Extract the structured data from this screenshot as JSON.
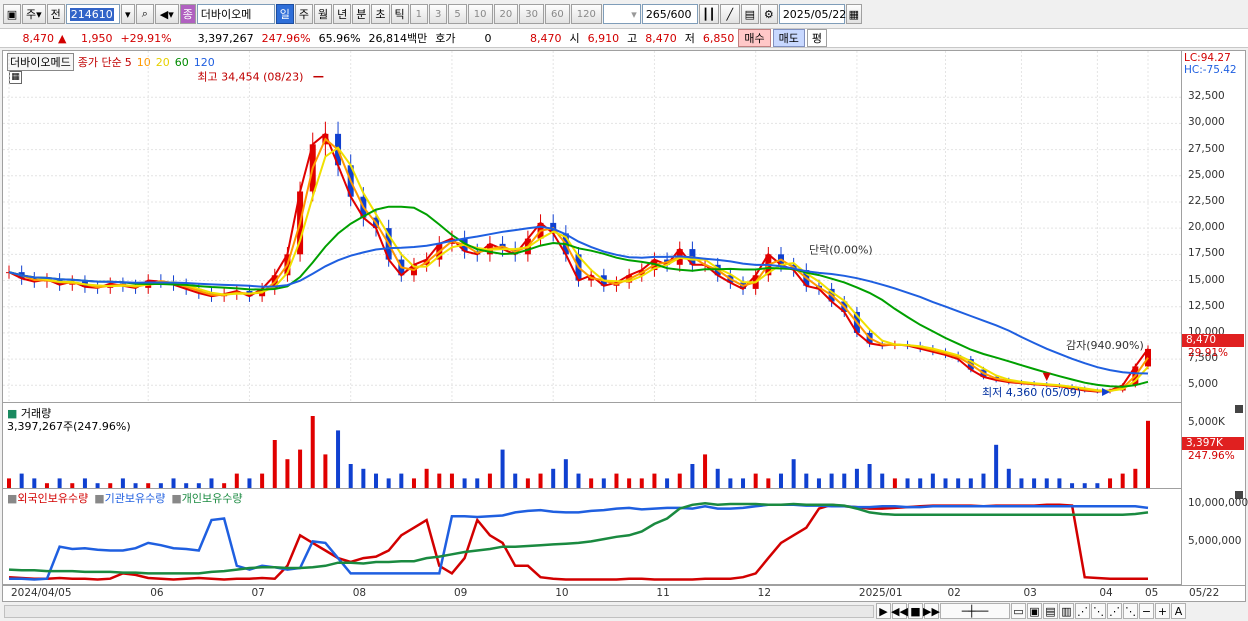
{
  "toolbar": {
    "market": "주",
    "jeon": "전",
    "code": "214610",
    "name_badge": "종",
    "stock_name": "더바이오메",
    "periods": [
      "일",
      "주",
      "월",
      "년",
      "분",
      "초",
      "틱"
    ],
    "active_period": "일",
    "nums": [
      "1",
      "3",
      "5",
      "10",
      "20",
      "30",
      "60",
      "120"
    ],
    "range": "265",
    "range_total": "/600",
    "date": "2025/05/22"
  },
  "quote": {
    "price": "8,470",
    "change": "1,950",
    "change_pct": "+29.91%",
    "volume": "3,397,267",
    "vol_ratio": "247.96%",
    "turnover": "65.96%",
    "amount": "26,814백만",
    "hoga_label": "호가",
    "hoga_value": "0",
    "hoga_price": "8,470",
    "open_label": "시",
    "open": "6,910",
    "high_label": "고",
    "high": "8,470",
    "low_label": "저",
    "low": "6,850",
    "buy": "매수",
    "sell": "매도",
    "pyeong": "평"
  },
  "price_pane": {
    "stock_box": "더바이오메드",
    "legend_title": "종가 단순",
    "ma": [
      {
        "label": "5",
        "color": "#e00000"
      },
      {
        "label": "10",
        "color": "#ff9900"
      },
      {
        "label": "20",
        "color": "#f0e000"
      },
      {
        "label": "60",
        "color": "#00a000"
      },
      {
        "label": "120",
        "color": "#1f5fe0"
      }
    ],
    "lc": "LC:94.27",
    "hc": "HC:-75.42",
    "ticks": [
      "32,500",
      "30,000",
      "27,500",
      "25,000",
      "22,500",
      "20,000",
      "17,500",
      "15,000",
      "12,500",
      "10,000",
      "7,500",
      "5,000"
    ],
    "price_tag": "8,470",
    "pct_tag": "29.91%",
    "annot_high": "최고 34,454 (08/23)",
    "annot_low": "최저 4,360 (05/09)",
    "annot_gamja": "감자(940.90%)",
    "annot_dan": "단락(0.00%)"
  },
  "volume_pane": {
    "title": "거래량",
    "sub": "3,397,267주(247.96%)",
    "tick": "5,000K",
    "tag": "3,397K",
    "tag_pct": "247.96%"
  },
  "holding_pane": {
    "legends": [
      {
        "label": "외국인보유수량",
        "color": "#d20000"
      },
      {
        "label": "기관보유수량",
        "color": "#1f5fe0"
      },
      {
        "label": "개인보유수량",
        "color": "#1a8a40"
      }
    ],
    "ticks": [
      "10,000,000",
      "5,000,000"
    ]
  },
  "xaxis": [
    "2024/04/05",
    "06",
    "07",
    "08",
    "09",
    "10",
    "11",
    "12",
    "2025/01",
    "02",
    "03",
    "04",
    "05",
    "05/22"
  ],
  "chart_data": {
    "type": "line",
    "ylim": [
      3500,
      35000
    ],
    "close": [
      15800,
      15200,
      14900,
      15100,
      14600,
      14900,
      14400,
      14300,
      14700,
      14500,
      14300,
      15000,
      14900,
      14600,
      14200,
      13800,
      13500,
      13700,
      14000,
      13500,
      14200,
      15500,
      17500,
      23500,
      28000,
      29000,
      26000,
      23000,
      21000,
      20000,
      17000,
      15500,
      16500,
      17000,
      18500,
      19000,
      17800,
      17500,
      18500,
      18000,
      17500,
      19000,
      20500,
      19500,
      17500,
      15000,
      15500,
      14500,
      14800,
      15500,
      16000,
      17000,
      16500,
      18000,
      16500,
      16500,
      15500,
      14800,
      14200,
      15500,
      17500,
      16500,
      16000,
      14500,
      14200,
      13000,
      12000,
      10000,
      9000,
      8800,
      8900,
      8800,
      8500,
      8200,
      7900,
      7500,
      6500,
      5800,
      5500,
      5300,
      5200,
      5100,
      5000,
      4900,
      4700,
      4500,
      4400,
      4500,
      5000,
      6800,
      8470
    ],
    "volume": [
      2,
      3,
      2,
      1,
      2,
      1,
      2,
      1,
      1,
      2,
      1,
      1,
      1,
      2,
      1,
      1,
      2,
      1,
      3,
      2,
      3,
      10,
      6,
      8,
      15,
      7,
      12,
      5,
      4,
      3,
      2,
      3,
      2,
      4,
      3,
      3,
      2,
      2,
      3,
      8,
      3,
      2,
      3,
      4,
      6,
      3,
      2,
      2,
      3,
      2,
      2,
      3,
      2,
      3,
      5,
      7,
      4,
      2,
      2,
      3,
      2,
      3,
      6,
      3,
      2,
      3,
      3,
      4,
      5,
      3,
      2,
      2,
      2,
      3,
      2,
      2,
      2,
      3,
      9,
      4,
      2,
      2,
      2,
      2,
      1,
      1,
      1,
      2,
      3,
      4,
      14
    ],
    "foreign": [
      500,
      400,
      300,
      300,
      400,
      300,
      300,
      200,
      300,
      1000,
      800,
      400,
      300,
      200,
      300,
      400,
      300,
      200,
      300,
      300,
      400,
      300,
      2000,
      6000,
      5000,
      4000,
      3000,
      2500,
      3000,
      3200,
      4000,
      6000,
      7000,
      8000,
      2000,
      1000,
      3000,
      8000,
      6000,
      5000,
      2000,
      2000,
      500,
      300,
      200,
      200,
      200,
      200,
      200,
      300,
      300,
      200,
      200,
      200,
      200,
      300,
      300,
      300,
      500,
      1000,
      3000,
      5000,
      6000,
      7000,
      9500,
      10000,
      9800,
      9700,
      9500,
      9500,
      9600,
      9700,
      9800,
      9900,
      9900,
      9900,
      9900,
      9800,
      9900,
      9900,
      9900,
      9900,
      10000,
      10000,
      9900,
      500,
      400,
      300,
      300,
      300,
      300
    ],
    "institution": [
      300,
      300,
      200,
      300,
      4500,
      4200,
      4300,
      4100,
      4000,
      4000,
      4300,
      5000,
      4700,
      4300,
      4200,
      4000,
      8000,
      8200,
      2000,
      1500,
      2000,
      1800,
      1500,
      1700,
      5200,
      5000,
      3000,
      1000,
      1000,
      1000,
      1000,
      1000,
      1000,
      1000,
      1000,
      8500,
      8500,
      8400,
      8500,
      8600,
      9000,
      9200,
      9300,
      9100,
      9000,
      9000,
      9200,
      9300,
      9500,
      9600,
      9400,
      9500,
      9600,
      9600,
      9500,
      9800,
      9500,
      9500,
      9600,
      9800,
      10000,
      10000,
      10000,
      9900,
      9900,
      9800,
      9800,
      9700,
      9700,
      9800,
      9800,
      9700,
      9700,
      9800,
      9800,
      9800,
      9800,
      9800,
      9800,
      9800,
      9800,
      9800,
      9800,
      9800,
      9800,
      9800,
      9800,
      9800,
      9800,
      9800,
      9600
    ],
    "individual": [
      1500,
      1400,
      1400,
      1300,
      1300,
      1300,
      1200,
      1200,
      1200,
      1100,
      1100,
      1000,
      1000,
      1000,
      1000,
      1000,
      1200,
      1300,
      1500,
      1700,
      1800,
      1800,
      1700,
      1700,
      1800,
      2000,
      2400,
      2400,
      2300,
      2500,
      2500,
      2600,
      2600,
      3000,
      3200,
      3500,
      3800,
      4000,
      4200,
      4500,
      4500,
      4600,
      4700,
      4800,
      4900,
      5000,
      5200,
      5500,
      5800,
      6000,
      6500,
      7500,
      8200,
      9500,
      10000,
      10200,
      10000,
      10100,
      10100,
      10100,
      10000,
      10000,
      10100,
      10000,
      10000,
      10000,
      9900,
      9500,
      9000,
      8800,
      8700,
      8700,
      8700,
      8700,
      8700,
      8700,
      8700,
      8700,
      8700,
      8700,
      8700,
      8700,
      8700,
      8700,
      8700,
      8700,
      8700,
      8700,
      8700,
      8800,
      9000
    ]
  }
}
